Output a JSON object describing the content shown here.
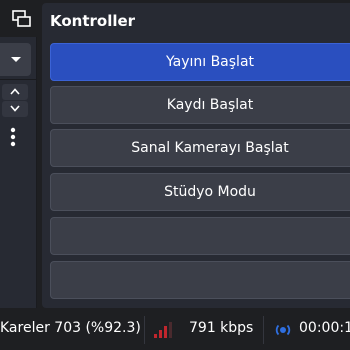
{
  "controls": {
    "title": "Kontroller",
    "buttons": {
      "stream": "Yayını Başlat",
      "record": "Kaydı Başlat",
      "vcam": "Sanal Kamerayı Başlat",
      "studio": "Stüdyo Modu",
      "settings": "",
      "exit": ""
    }
  },
  "status_bar": {
    "frames": "Kareler 703 (%92.3)",
    "bitrate": "791 kbps",
    "time": "00:00:1"
  },
  "colors": {
    "accent": "#2a4fbf",
    "signal": "#c0262d",
    "stream_indicator": "#2f6fe0",
    "panel": "#272a33",
    "button": "#3b3e48",
    "background": "#1e1f22"
  },
  "icons": {
    "undock": "undock-icon",
    "dropdown": "chevron-down-icon",
    "up": "chevron-up-icon",
    "down": "chevron-down-icon",
    "more": "more-vertical-icon",
    "signal": "signal-bars-icon",
    "stream": "broadcast-icon"
  }
}
